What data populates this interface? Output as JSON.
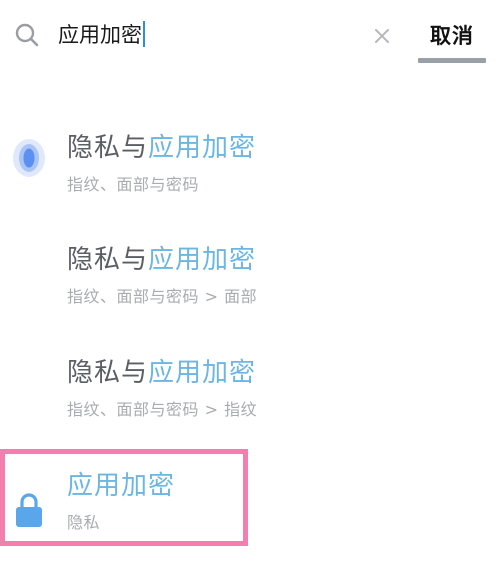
{
  "search": {
    "query": "应用加密",
    "clear_icon": "close-icon",
    "cancel_label": "取消"
  },
  "colors": {
    "accent_highlight": "#6cb6e4",
    "title_text": "#5a5f66",
    "subtitle_text": "#a8abb0",
    "annotation_box": "#f47fae",
    "cancel_underline": "#9aa0a8"
  },
  "results": [
    {
      "icon": "fingerprint-icon",
      "title_prefix": "隐私与",
      "title_highlight": "应用加密",
      "subtitle": "指纹、面部与密码"
    },
    {
      "icon": "",
      "title_prefix": "隐私与",
      "title_highlight": "应用加密",
      "subtitle": "指纹、面部与密码 > 面部"
    },
    {
      "icon": "",
      "title_prefix": "隐私与",
      "title_highlight": "应用加密",
      "subtitle": "指纹、面部与密码 > 指纹"
    },
    {
      "icon": "lock-icon",
      "title_prefix": "",
      "title_highlight": "应用加密",
      "subtitle": "隐私"
    }
  ]
}
